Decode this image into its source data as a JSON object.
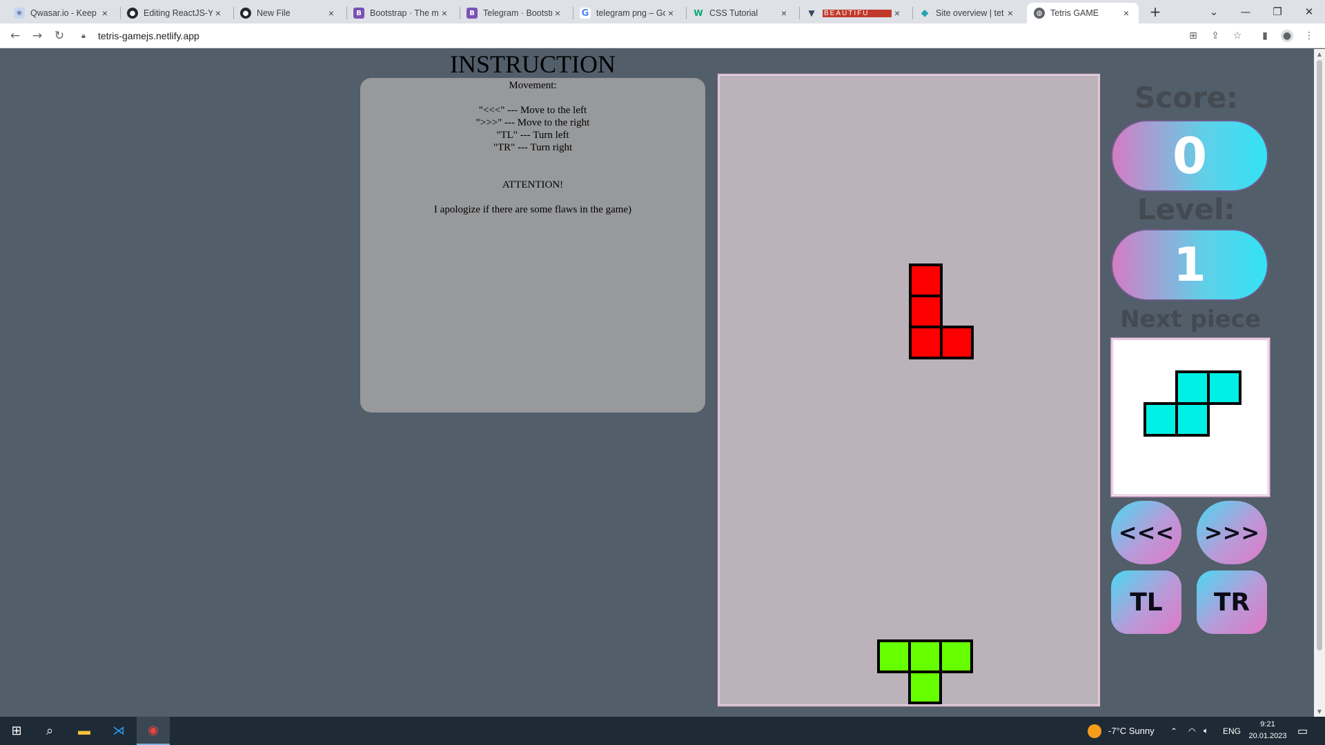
{
  "browser": {
    "tabs": [
      {
        "title": "Qwasar.io - Keep G",
        "icon": "qwasar-icon",
        "color": "#9bb0d6"
      },
      {
        "title": "Editing ReactJS-Yel",
        "icon": "github-icon",
        "color": "#24292f"
      },
      {
        "title": "New File",
        "icon": "github-icon",
        "color": "#24292f"
      },
      {
        "title": "Bootstrap · The mo",
        "icon": "bootstrap-icon",
        "color": "#7952b3"
      },
      {
        "title": "Telegram · Bootstra",
        "icon": "bootstrap-icon",
        "color": "#7952b3"
      },
      {
        "title": "telegram png – Go",
        "icon": "google-icon",
        "color": "#4285f4"
      },
      {
        "title": "CSS Tutorial",
        "icon": "w3schools-icon",
        "color": "#04aa6d"
      },
      {
        "title": "BEAUTIFU",
        "icon": "vue-icon",
        "color": "#41b883"
      },
      {
        "title": "Site overview | tet",
        "icon": "netlify-icon",
        "color": "#20a4b0"
      },
      {
        "title": "Tetris GAME",
        "icon": "globe-icon",
        "color": "#5f6368",
        "active": true
      }
    ],
    "new_tab_symbol": "+",
    "window_controls": {
      "dropdown": "⌄",
      "minimize": "—",
      "restore": "❐",
      "close": "✕"
    },
    "url": "tetris-gamejs.netlify.app"
  },
  "instructions": {
    "title": "INSTRUCTION",
    "movement_heading": "Movement:",
    "lines": [
      "\"<<<\" --- Move to the left",
      "\">>>\" --- Move to the right",
      "\"TL\" --- Turn left",
      "\"TR\" --- Turn right"
    ],
    "attention": "ATTENTION!",
    "apology": "I apologize if there are some flaws in the game)"
  },
  "game": {
    "score_label": "Score:",
    "score": "0",
    "level_label": "Level:",
    "level": "1",
    "next_label": "Next piece",
    "colors": {
      "falling": "#ff0000",
      "landed": "#66ff00",
      "next": "#00f0e6",
      "board": "#bbb2ba"
    },
    "falling_piece": {
      "shape": "L",
      "cells": [
        [
          0,
          0
        ],
        [
          0,
          1
        ],
        [
          0,
          2
        ],
        [
          1,
          2
        ]
      ]
    },
    "landed_piece": {
      "shape": "T",
      "cells": [
        [
          0,
          0
        ],
        [
          1,
          0
        ],
        [
          2,
          0
        ],
        [
          1,
          1
        ]
      ]
    },
    "next_piece": {
      "shape": "S",
      "cells": [
        [
          1,
          0
        ],
        [
          2,
          0
        ],
        [
          0,
          1
        ],
        [
          1,
          1
        ]
      ]
    }
  },
  "controls": {
    "left": "<<<",
    "right": ">>>",
    "turn_left": "TL",
    "turn_right": "TR"
  },
  "taskbar": {
    "weather": "-7°C  Sunny",
    "language": "ENG",
    "time": "9:21",
    "date": "20.01.2023"
  }
}
